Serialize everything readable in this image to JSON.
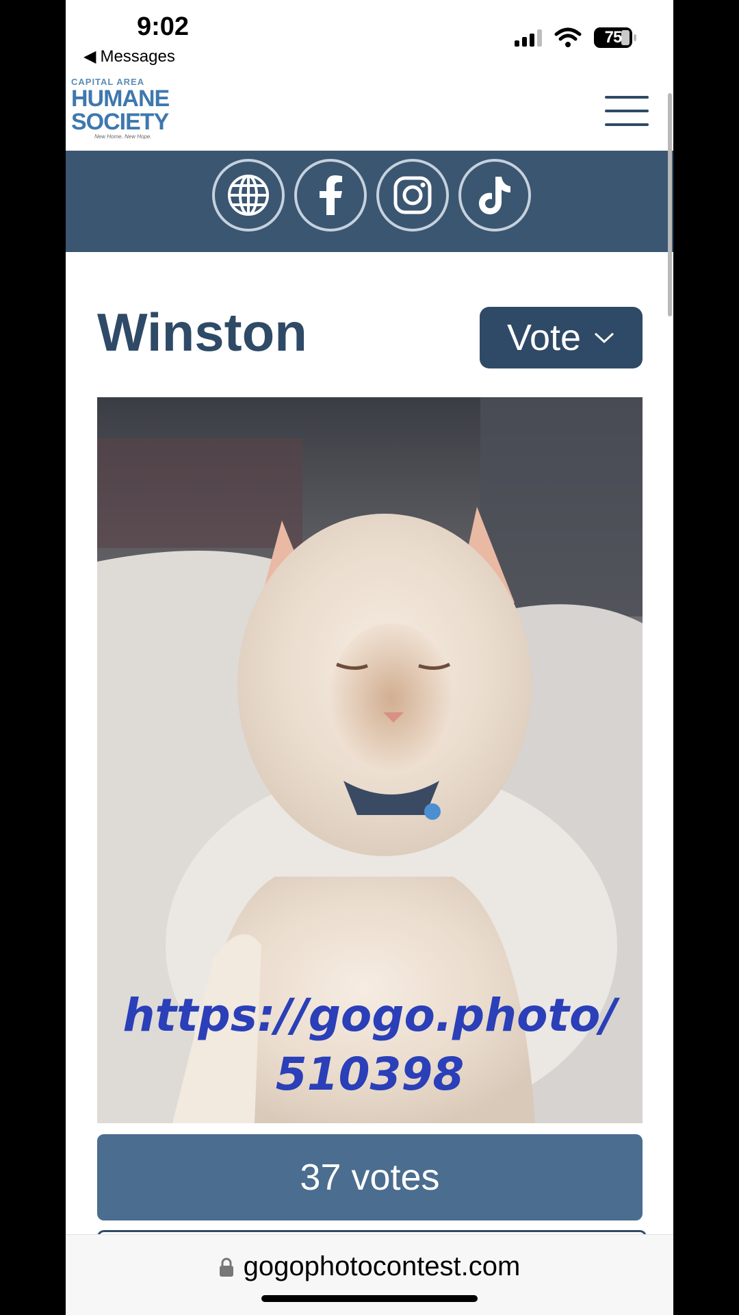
{
  "status_bar": {
    "time": "9:02",
    "back_label": "Messages",
    "battery": "75"
  },
  "header": {
    "logo": {
      "line1": "CAPITAL AREA",
      "line2": "HUMANE",
      "line3": "SOCIETY",
      "tagline": "New Home. New Hope."
    },
    "menu_icon": "hamburger-icon"
  },
  "social": {
    "items": [
      {
        "icon": "globe-icon"
      },
      {
        "icon": "facebook-icon"
      },
      {
        "icon": "instagram-icon"
      },
      {
        "icon": "tiktok-icon"
      }
    ]
  },
  "entry": {
    "name": "Winston",
    "vote_label": "Vote",
    "photo_url_line1": "https://gogo.photo/",
    "photo_url_line2": "510398",
    "votes_label": "37 votes"
  },
  "browser": {
    "domain": "gogophotocontest.com"
  },
  "colors": {
    "brand_dark": "#2f4a66",
    "band": "#3b5671",
    "votes_bar": "#4b6d8f",
    "logo_blue": "#3e78ad",
    "overlay_text": "#2a3fb8"
  }
}
